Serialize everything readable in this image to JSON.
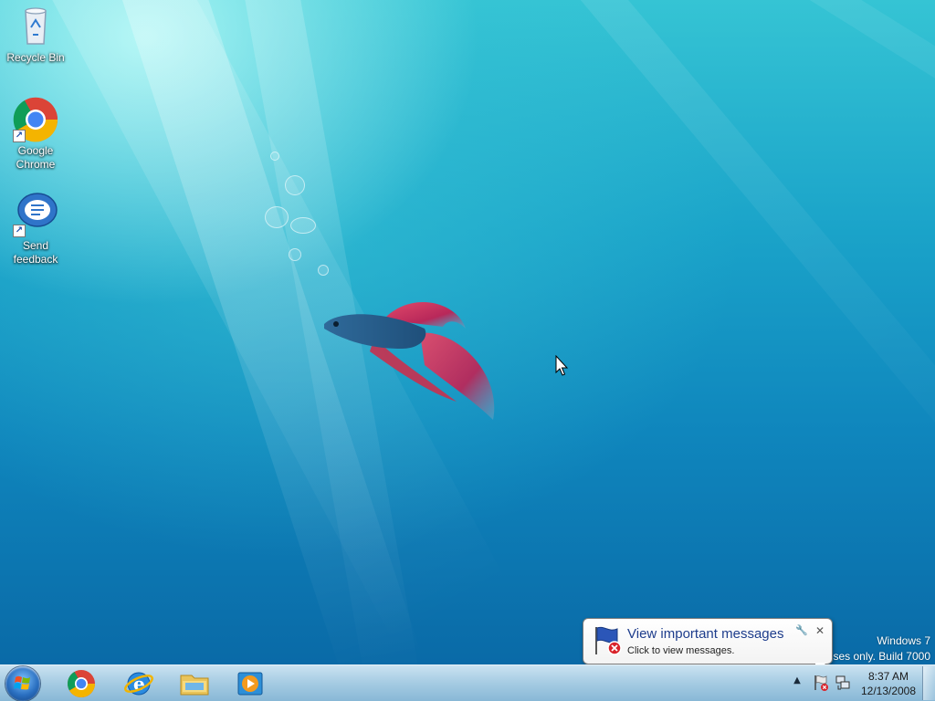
{
  "desktop": {
    "icons": [
      {
        "label": "Recycle Bin",
        "icon": "recycle-bin-icon"
      },
      {
        "label": "Google Chrome",
        "icon": "chrome-icon"
      },
      {
        "label": "Send feedback",
        "icon": "feedback-icon"
      }
    ]
  },
  "watermark": {
    "line1": "Windows 7",
    "line2": "ses only. Build 7000"
  },
  "notification": {
    "title": "View important messages",
    "text": "Click to view messages.",
    "icon": "action-center-flag-icon"
  },
  "taskbar": {
    "start": "windows-orb-icon",
    "pinned": [
      "chrome-icon",
      "internet-explorer-icon",
      "windows-explorer-icon",
      "media-player-icon"
    ],
    "clock": {
      "time": "8:37 AM",
      "date": "12/13/2008"
    }
  },
  "colors": {
    "wallpaper_top": "#35c4d4",
    "wallpaper_bottom": "#0a6aa7",
    "balloon_title": "#1e3d8c"
  }
}
